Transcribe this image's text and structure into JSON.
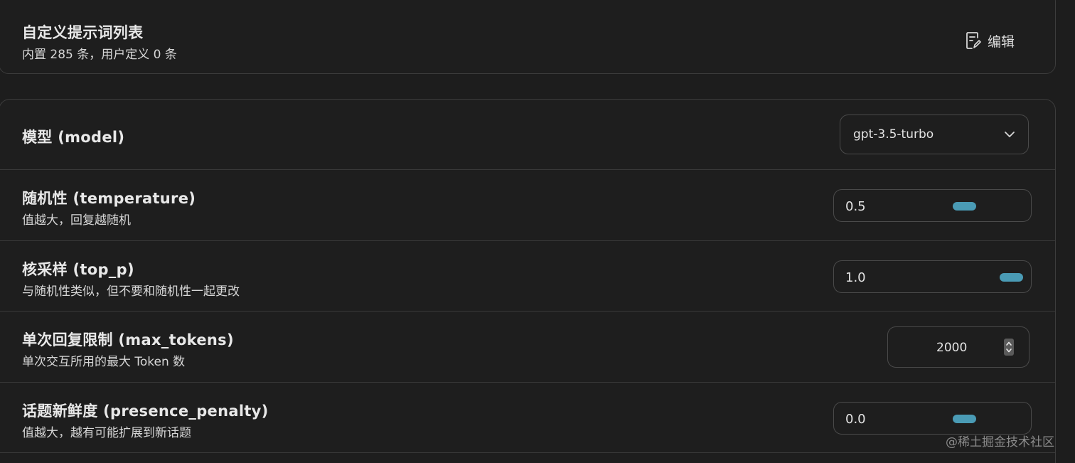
{
  "prompt_list": {
    "title": "自定义提示词列表",
    "subtitle": "内置 285 条，用户定义 0 条",
    "edit_label": "编辑"
  },
  "settings": {
    "model": {
      "title": "模型 (model)",
      "value": "gpt-3.5-turbo"
    },
    "temperature": {
      "title": "随机性 (temperature)",
      "subtitle": "值越大，回复越随机",
      "value": "0.5",
      "fraction": 0.5
    },
    "top_p": {
      "title": "核采样 (top_p)",
      "subtitle": "与随机性类似，但不要和随机性一起更改",
      "value": "1.0",
      "fraction": 1.0
    },
    "max_tokens": {
      "title": "单次回复限制 (max_tokens)",
      "subtitle": "单次交互所用的最大 Token 数",
      "value": "2000"
    },
    "presence_penalty": {
      "title": "话题新鲜度 (presence_penalty)",
      "subtitle": "值越大，越有可能扩展到新话题",
      "value": "0.0",
      "fraction": 0.5
    }
  },
  "watermark": "@稀土掘金技术社区",
  "colors": {
    "accent": "#4a9bb5",
    "background": "#1d1d1d",
    "border": "#3c3c3c"
  },
  "icons": {
    "edit": "edit-document-icon",
    "select": "chevron-down-icon",
    "spinner": "spinner-arrows-icon"
  }
}
